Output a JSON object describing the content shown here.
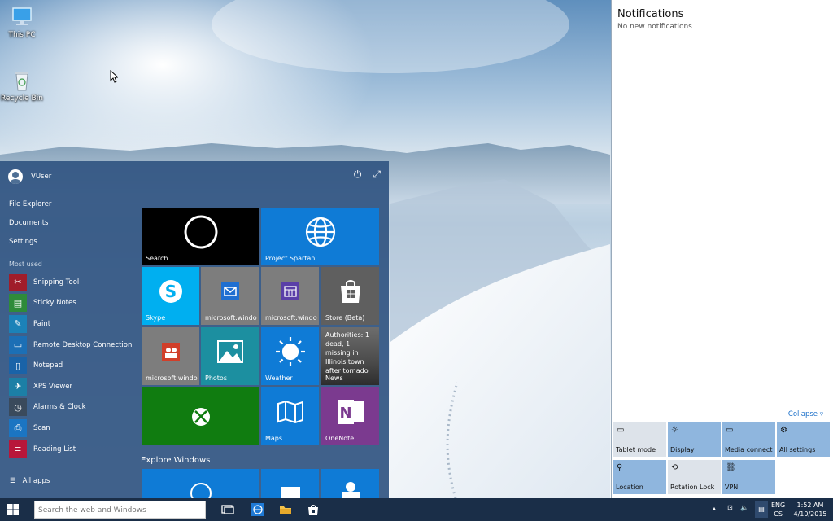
{
  "desktop": {
    "icons": [
      {
        "label": "This PC",
        "icon": "computer-icon"
      },
      {
        "label": "Recycle Bin",
        "icon": "recycle-bin-icon"
      }
    ]
  },
  "start": {
    "user": "VUser",
    "places": [
      "File Explorer",
      "Documents",
      "Settings"
    ],
    "most_used_label": "Most used",
    "apps": [
      {
        "label": "Snipping Tool",
        "icon": "snipping-tool-icon",
        "color": "#a01d2a"
      },
      {
        "label": "Sticky Notes",
        "icon": "sticky-notes-icon",
        "color": "#2e8b3a"
      },
      {
        "label": "Paint",
        "icon": "paint-icon",
        "color": "#1b82b8"
      },
      {
        "label": "Remote Desktop Connection",
        "icon": "remote-desktop-icon",
        "color": "#1c6fb5"
      },
      {
        "label": "Notepad",
        "icon": "notepad-icon",
        "color": "#1a63a8"
      },
      {
        "label": "XPS Viewer",
        "icon": "xps-viewer-icon",
        "color": "#1c7fa6"
      },
      {
        "label": "Alarms & Clock",
        "icon": "alarm-clock-icon",
        "color": "#3a4a5c"
      },
      {
        "label": "Scan",
        "icon": "scan-icon",
        "color": "#1b75c2"
      },
      {
        "label": "Reading List",
        "icon": "reading-list-icon",
        "color": "#b8163a"
      }
    ],
    "all_apps": "All apps",
    "explore": "Explore Windows",
    "tiles": {
      "search": "Search",
      "spartan": "Project Spartan",
      "skype": "Skype",
      "mail": "microsoft.windo",
      "calendar": "microsoft.windo",
      "store": "Store (Beta)",
      "people": "microsoft.windo",
      "photos": "Photos",
      "weather": "Weather",
      "news_headline": "Authorities: 1 dead, 1 missing in Illinois town after tornado",
      "news": "News",
      "maps": "Maps",
      "onenote": "OneNote"
    }
  },
  "action_center": {
    "title": "Notifications",
    "subtitle": "No new notifications",
    "collapse": "Collapse",
    "quick_actions": [
      {
        "label": "Tablet mode",
        "icon": "tablet-mode-icon",
        "on": false
      },
      {
        "label": "Display",
        "icon": "display-icon",
        "on": true
      },
      {
        "label": "Media connect",
        "icon": "media-connect-icon",
        "on": true
      },
      {
        "label": "All settings",
        "icon": "settings-gear-icon",
        "on": true
      },
      {
        "label": "Location",
        "icon": "location-icon",
        "on": true
      },
      {
        "label": "Rotation Lock",
        "icon": "rotation-lock-icon",
        "on": false
      },
      {
        "label": "VPN",
        "icon": "vpn-icon",
        "on": true
      }
    ]
  },
  "taskbar": {
    "search_placeholder": "Search the web and Windows",
    "lang_top": "ENG",
    "lang_bottom": "CS",
    "time": "1:52 AM",
    "date": "4/10/2015"
  },
  "colors": {
    "start_bg": "#325582",
    "tile_blue": "#0f7bd6",
    "tile_gray": "#7d7d7d",
    "tile_teal": "#1c8fa0",
    "tile_green": "#107c10",
    "tile_purple": "#7b3a8f",
    "quick_on": "#8fb6de",
    "taskbar": "#1a2e48"
  }
}
